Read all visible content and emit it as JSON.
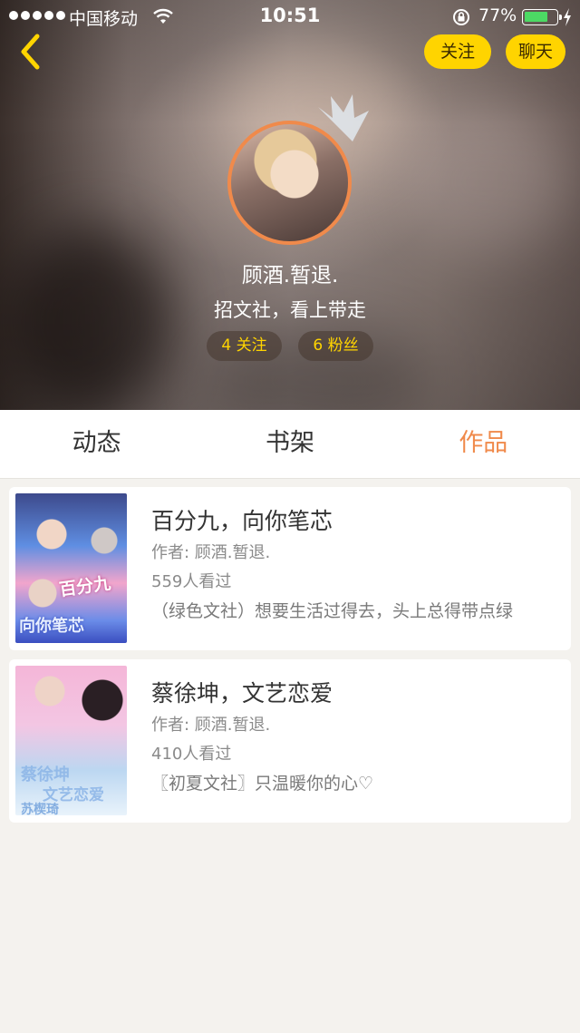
{
  "status_bar": {
    "carrier": "中国移动",
    "time": "10:51",
    "battery": "77%",
    "battery_level": 0.77,
    "battery_color": "#4cd964"
  },
  "top_bar": {
    "back_icon": "chevron-left-icon",
    "follow_label": "关注",
    "chat_label": "聊天",
    "button_color": "#ffd400"
  },
  "profile": {
    "avatar_border_color": "#f08a4b",
    "badge_icon": "crown-icon",
    "name": "顾酒.暂退.",
    "motto": "招文社，看上带走",
    "following": "4 关注",
    "fans": "6 粉丝"
  },
  "tabs": [
    {
      "label": "动态",
      "active": false
    },
    {
      "label": "书架",
      "active": false
    },
    {
      "label": "作品",
      "active": true
    }
  ],
  "accent_color": "#f08a4b",
  "works": [
    {
      "title": "百分九，向你笔芯",
      "author": "作者: 顾酒.暂退.",
      "views": "559人看过",
      "description": "（绿色文社）想要生活过得去，头上总得带点绿",
      "cover_text": [
        "百分九",
        "向你笔芯"
      ]
    },
    {
      "title": "蔡徐坤，文艺恋爱",
      "author": "作者: 顾酒.暂退.",
      "views": "410人看过",
      "description": "〖初夏文社〗只温暖你的心♡",
      "cover_text": [
        "蔡徐坤",
        "文艺恋爱",
        "苏楔琦"
      ]
    }
  ]
}
